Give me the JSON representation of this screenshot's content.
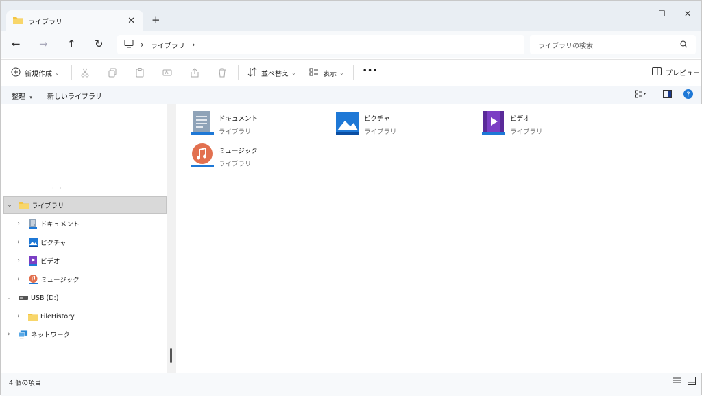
{
  "tab": {
    "title": "ライブラリ",
    "close": "✕",
    "new": "+"
  },
  "window_controls": {
    "minimize": "—",
    "maximize": "☐",
    "close": "✕"
  },
  "nav": {
    "back": "←",
    "forward": "→",
    "up": "↑",
    "refresh": "↻"
  },
  "address": {
    "separator": "›",
    "crumb": "ライブラリ",
    "trailing": "›"
  },
  "search": {
    "placeholder": "ライブラリの検索"
  },
  "toolbar": {
    "new_label": "新規作成",
    "sort_label": "並べ替え",
    "view_label": "表示",
    "more": "•••",
    "preview_label": "プレビュー"
  },
  "menubar": {
    "organize": "整理",
    "new_library": "新しいライブラリ"
  },
  "sidebar": {
    "items": [
      {
        "label": "ライブラリ",
        "expander": "⌄",
        "icon": "folder-icon"
      },
      {
        "label": "ドキュメント",
        "expander": "›",
        "icon": "documents-icon"
      },
      {
        "label": "ピクチャ",
        "expander": "›",
        "icon": "pictures-icon"
      },
      {
        "label": "ビデオ",
        "expander": "›",
        "icon": "videos-icon"
      },
      {
        "label": "ミュージック",
        "expander": "›",
        "icon": "music-icon"
      },
      {
        "label": "USB (D:)",
        "expander": "⌄",
        "icon": "drive-icon"
      },
      {
        "label": "FileHistory",
        "expander": "›",
        "icon": "folder-icon"
      },
      {
        "label": "ネットワーク",
        "expander": "›",
        "icon": "network-icon"
      }
    ],
    "dots": "· ·"
  },
  "libraries": [
    {
      "name": "ドキュメント",
      "type": "ライブラリ",
      "icon": "documents-icon"
    },
    {
      "name": "ピクチャ",
      "type": "ライブラリ",
      "icon": "pictures-icon"
    },
    {
      "name": "ビデオ",
      "type": "ライブラリ",
      "icon": "videos-icon"
    },
    {
      "name": "ミュージック",
      "type": "ライブラリ",
      "icon": "music-icon"
    }
  ],
  "status": {
    "count_text": "4 個の項目"
  },
  "colors": {
    "accent": "#0067c0",
    "folder": "#f4c542",
    "video": "#7b3fc4",
    "music": "#e2704f"
  }
}
